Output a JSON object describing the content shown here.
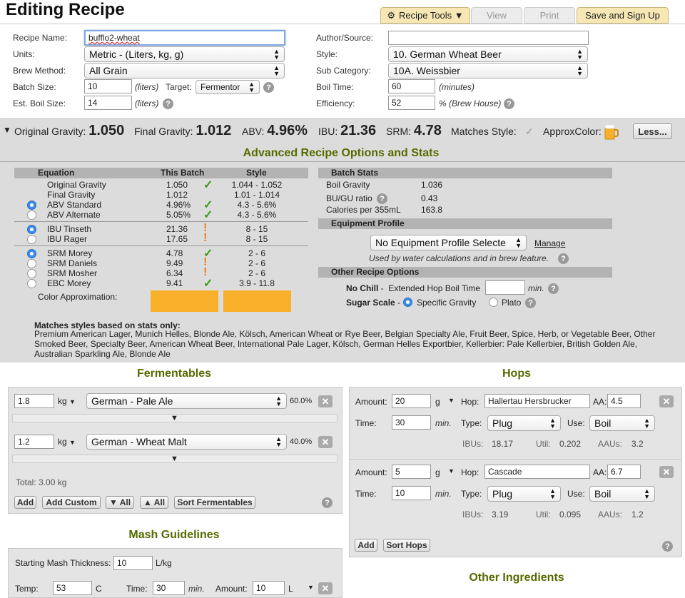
{
  "header": {
    "title": "Editing Recipe",
    "tabs": {
      "recipe_tools": "Recipe Tools ▼",
      "view": "View",
      "print": "Print",
      "save": "Save and Sign Up"
    }
  },
  "form": {
    "recipe_name_label": "Recipe Name:",
    "recipe_name": "bufflo2-wheat",
    "units_label": "Units:",
    "units": "Metric - (Liters, kg, g)",
    "brew_method_label": "Brew Method:",
    "brew_method": "All Grain",
    "batch_size_label": "Batch Size:",
    "batch_size": "10",
    "batch_size_unit": "(liters)",
    "target_label": "Target:",
    "target": "Fermentor",
    "boil_size_label": "Est. Boil Size:",
    "boil_size": "14",
    "boil_size_unit": "(liters)",
    "author_label": "Author/Source:",
    "author": "",
    "style_label": "Style:",
    "style": "10. German Wheat Beer",
    "subcat_label": "Sub Category:",
    "subcat": "10A. Weissbier",
    "boil_time_label": "Boil Time:",
    "boil_time": "60",
    "boil_time_unit": "(minutes)",
    "efficiency_label": "Efficiency:",
    "efficiency": "52",
    "efficiency_unit": "% (Brew House)"
  },
  "summary": {
    "og_label": "Original Gravity:",
    "og": "1.050",
    "fg_label": "Final Gravity:",
    "fg": "1.012",
    "abv_label": "ABV:",
    "abv": "4.96%",
    "ibu_label": "IBU:",
    "ibu": "21.36",
    "srm_label": "SRM:",
    "srm": "4.78",
    "matches_label": "Matches Style:",
    "color_label": "ApproxColor:",
    "less_button": "Less..."
  },
  "advanced": {
    "heading": "Advanced Recipe Options and Stats",
    "col_equation": "Equation",
    "col_batch": "This Batch",
    "col_style": "Style",
    "rows": [
      {
        "name": "Original Gravity",
        "batch": "1.050",
        "style": "1.044 - 1.052",
        "mark": "check"
      },
      {
        "name": "Final Gravity",
        "batch": "1.012",
        "style": "1.01 - 1.014",
        "mark": ""
      },
      {
        "name": "ABV Standard",
        "batch": "4.96%",
        "style": "4.3 - 5.6%",
        "mark": "check"
      },
      {
        "name": "ABV Alternate",
        "batch": "5.05%",
        "style": "4.3 - 5.6%",
        "mark": "check"
      },
      {
        "name": "IBU Tinseth",
        "batch": "21.36",
        "style": "8 - 15",
        "mark": "warn"
      },
      {
        "name": "IBU Rager",
        "batch": "17.65",
        "style": "8 - 15",
        "mark": "warn"
      },
      {
        "name": "SRM Morey",
        "batch": "4.78",
        "style": "2 - 6",
        "mark": "check"
      },
      {
        "name": "SRM Daniels",
        "batch": "9.49",
        "style": "2 - 6",
        "mark": "warn"
      },
      {
        "name": "SRM Mosher",
        "batch": "6.34",
        "style": "2 - 6",
        "mark": "warn"
      },
      {
        "name": "EBC Morey",
        "batch": "9.41",
        "style": "3.9 - 11.8",
        "mark": "check"
      }
    ],
    "color_approx_label": "Color Approximation:",
    "swatch_color": "#f9b12c",
    "matches_heading": "Matches styles based on stats only:",
    "matches_text": "Premium American Lager, Munich Helles, Blonde Ale, Kölsch, American Wheat or Rye Beer, Belgian Specialty Ale, Fruit Beer, Spice, Herb, or Vegetable Beer, Other Smoked Beer, Specialty Beer, American Wheat Beer, International Pale Lager, Kölsch, German Helles Exportbier, Kellerbier: Pale Kellerbier, British Golden Ale, Australian Sparkling Ale, Blonde Ale",
    "batch_stats": {
      "heading": "Batch Stats",
      "boil_gravity_label": "Boil Gravity",
      "boil_gravity": "1.036",
      "bugu_label": "BU/GU ratio",
      "bugu": "0.43",
      "calories_label": "Calories per 355mL",
      "calories": "163.8"
    },
    "equipment": {
      "heading": "Equipment Profile",
      "select": "No Equipment Profile Selecte",
      "manage": "Manage",
      "note": "Used by water calculations and in brew feature."
    },
    "other": {
      "heading": "Other Recipe Options",
      "nochill_label": "No Chill",
      "nochill_text": "Extended Hop Boil Time",
      "nochill_unit": "min.",
      "sugar_label": "Sugar Scale",
      "sg_option": "Specific Gravity",
      "plato_option": "Plato"
    }
  },
  "fermentables": {
    "heading": "Fermentables",
    "items": [
      {
        "amount": "1.8",
        "unit": "kg",
        "name": "German - Pale Ale",
        "pct": "60.0%"
      },
      {
        "amount": "1.2",
        "unit": "kg",
        "name": "German - Wheat Malt",
        "pct": "40.0%"
      }
    ],
    "total": "Total: 3.00 kg",
    "buttons": {
      "add": "Add",
      "add_custom": "Add Custom",
      "down_all": "▼ All",
      "up_all": "▲ All",
      "sort": "Sort Fermentables"
    }
  },
  "mash": {
    "heading": "Mash Guidelines",
    "thickness_label": "Starting Mash Thickness:",
    "thickness": "10",
    "thickness_unit": "L/kg",
    "temp_label": "Temp:",
    "temp": "53",
    "temp_unit": "C",
    "time_label": "Time:",
    "time": "30",
    "time_unit": "min.",
    "amount_label": "Amount:",
    "amount": "10",
    "amount_unit": "L"
  },
  "hops": {
    "heading": "Hops",
    "labels": {
      "amount": "Amount:",
      "time": "Time:",
      "hop": "Hop:",
      "aa": "AA:",
      "type": "Type:",
      "use": "Use:",
      "ibus": "IBUs:",
      "util": "Util:",
      "aaus": "AAUs:",
      "min": "min."
    },
    "items": [
      {
        "amount": "20",
        "unit": "g",
        "name": "Hallertau Hersbrucker",
        "aa": "4.5",
        "time": "30",
        "type": "Plug",
        "use": "Boil",
        "ibus": "18.17",
        "util": "0.202",
        "aaus": "3.2"
      },
      {
        "amount": "5",
        "unit": "g",
        "name": "Cascade",
        "aa": "6.7",
        "time": "10",
        "type": "Plug",
        "use": "Boil",
        "ibus": "3.19",
        "util": "0.095",
        "aaus": "1.2"
      }
    ],
    "buttons": {
      "add": "Add",
      "sort": "Sort Hops"
    }
  },
  "other_ingredients": {
    "heading": "Other Ingredients"
  }
}
